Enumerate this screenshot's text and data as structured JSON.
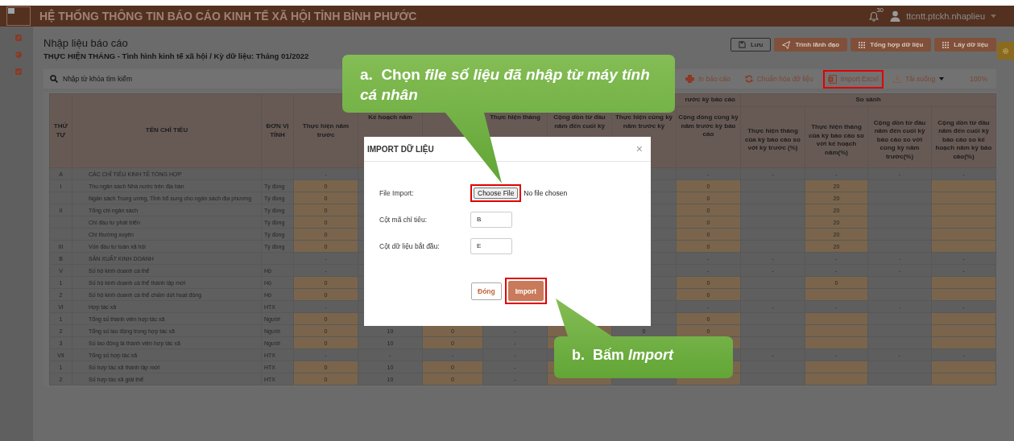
{
  "header": {
    "title": "HỆ THỐNG THÔNG TIN BÁO CÁO KINH TẾ XÃ HỘI TỈNH BÌNH PHƯỚC",
    "notification_count": "30",
    "username": "ttcntt.ptckh.nhaplieu"
  },
  "page": {
    "title": "Nhập liệu báo cáo",
    "subtitle": "THỰC HIỆN THÁNG - Tình hình kinh tế xã hội / Kỳ dữ liệu: Tháng 01/2022"
  },
  "toolbar_buttons": [
    {
      "kind": "save",
      "label": "Lưu"
    },
    {
      "kind": "send",
      "label": "Trình lãnh đạo"
    },
    {
      "kind": "grid",
      "label": "Tổng hợp dữ liệu"
    },
    {
      "kind": "grid",
      "label": "Lấy dữ liệu"
    }
  ],
  "search": {
    "placeholder": "Nhập từ khóa tìm kiếm"
  },
  "actions": [
    {
      "kind": "print",
      "label": "In báo cáo",
      "highlighted": false
    },
    {
      "kind": "refresh",
      "label": "Chuẩn hóa dữ liệu",
      "highlighted": false
    },
    {
      "kind": "excel",
      "label": "Import Excel",
      "highlighted": true
    },
    {
      "kind": "download",
      "label": "Tải xuống",
      "highlighted": false
    }
  ],
  "zoom": "100%",
  "table": {
    "header": [
      {
        "label": "THỨ TỰ",
        "editable": false
      },
      {
        "label": "TÊN CHỈ TIÊU",
        "editable": false
      },
      {
        "label": "ĐƠN VỊ TÍNH",
        "editable": false
      },
      {
        "label": "Thực hiện năm trước",
        "editable": true
      },
      {
        "columns": [
          {
            "label": "Kế hoạch năm",
            "editable": false
          },
          {
            "editable": true
          },
          {
            "label": "Thực hiện tháng",
            "editable": false
          },
          {
            "label": "Cộng dồn từ đầu năm đến cuối kỳ",
            "editable": true
          }
        ]
      },
      {
        "label": "rước kỳ báo cáo",
        "columns": [
          {
            "label": "Thực hiện cùng kỳ năm trước kỳ",
            "editable": false
          },
          {
            "label": "Cộng dồng cùng kỳ năm trước kỳ báo cáo",
            "editable": true
          }
        ]
      },
      {
        "label": "So sánh",
        "columns": [
          {
            "label": "Thực hiện tháng của kỳ báo cáo so với kỳ trước (%)",
            "editable": false
          },
          {
            "label": "Thực hiện tháng của kỳ báo cáo so với kế hoạch năm(%)",
            "editable": true
          },
          {
            "label": "Cộng dồn từ đầu năm đến cuối kỳ báo cáo so với cùng kỳ năm trước(%)",
            "editable": false
          },
          {
            "label": "Cộng dồn từ đầu năm đến cuối kỳ báo cáo so kế hoạch năm kỳ báo cáo(%)",
            "editable": true
          }
        ]
      }
    ],
    "rows": [
      {
        "kind": "section",
        "cells": [
          "A",
          "CÁC CHỈ TIÊU KINH TẾ TỔNG HỢP",
          null,
          "-",
          null,
          null,
          null,
          null,
          null,
          "-",
          "-",
          "-",
          "-",
          "-"
        ]
      },
      {
        "kind": "item",
        "cells": [
          "I",
          "Thu ngân sách Nhà nước trên địa bàn",
          "Tỷ đồng",
          "0",
          null,
          null,
          null,
          null,
          null,
          "0",
          null,
          "20",
          null,
          null
        ]
      },
      {
        "kind": "item",
        "cells": [
          null,
          "Ngân sách Trung ương, Tỉnh bổ sung cho ngân sách địa phương",
          "Tỷ đồng",
          "0",
          null,
          null,
          null,
          null,
          null,
          "0",
          null,
          "20",
          null,
          null
        ]
      },
      {
        "kind": "item",
        "cells": [
          "II",
          "Tổng chi ngân sách",
          "Tỷ đồng",
          "0",
          null,
          null,
          null,
          null,
          null,
          "0",
          null,
          "20",
          null,
          null
        ]
      },
      {
        "kind": "item",
        "cells": [
          null,
          "Chi đầu tư phát triển",
          "Tỷ đồng",
          "0",
          null,
          null,
          null,
          null,
          null,
          "0",
          null,
          "20",
          null,
          null
        ]
      },
      {
        "kind": "item",
        "cells": [
          null,
          "Chi thường xuyên",
          "Tỷ đồng",
          "0",
          null,
          null,
          null,
          null,
          null,
          "0",
          null,
          "20",
          null,
          null
        ]
      },
      {
        "kind": "item",
        "cells": [
          "III",
          "Vốn đầu tư toàn xã hội",
          "Tỷ đồng",
          "0",
          null,
          null,
          null,
          null,
          null,
          "0",
          null,
          "20",
          null,
          null
        ]
      },
      {
        "kind": "section",
        "cells": [
          "B",
          "SẢN XUẤT KINH DOANH",
          null,
          "-",
          null,
          null,
          null,
          null,
          null,
          "-",
          "-",
          "-",
          "-",
          "-"
        ]
      },
      {
        "kind": "section",
        "cells": [
          "V",
          "Số hộ kinh doanh cá thể",
          "Hộ",
          "-",
          null,
          null,
          null,
          null,
          null,
          "-",
          "-",
          "-",
          "-",
          "-"
        ]
      },
      {
        "kind": "item",
        "cells": [
          "1",
          "Số hộ kinh doanh cá thể thành lập mới",
          "Hộ",
          "0",
          null,
          null,
          null,
          null,
          null,
          "0",
          null,
          "0",
          null,
          null
        ]
      },
      {
        "kind": "item",
        "cells": [
          "2",
          "Số hộ kinh doanh cá thể chấm dứt hoạt động",
          "Hộ",
          "0",
          null,
          null,
          null,
          null,
          null,
          "0",
          null,
          null,
          null,
          null
        ]
      },
      {
        "kind": "section",
        "cells": [
          "VI",
          "Hợp tác xã",
          "HTX",
          "-",
          null,
          null,
          null,
          null,
          null,
          "-",
          "-",
          "-",
          "-",
          "-"
        ]
      },
      {
        "kind": "item",
        "cells": [
          "1",
          "Tổng số thành viên hợp tác xã",
          "Người",
          "0",
          null,
          null,
          null,
          null,
          null,
          "0",
          null,
          null,
          null,
          null
        ]
      },
      {
        "kind": "item",
        "cells": [
          "2",
          "Tổng số lao động trong hợp tác xã",
          "Người",
          "0",
          "10",
          "0",
          "-",
          null,
          "0",
          "0",
          null,
          null,
          null,
          null
        ]
      },
      {
        "kind": "item",
        "cells": [
          "3",
          "Số lao động là thành viên hợp tác xã",
          "Người",
          "0",
          "10",
          "0",
          "-",
          null,
          null,
          null,
          null,
          null,
          null,
          null
        ]
      },
      {
        "kind": "section",
        "cells": [
          "VII",
          "Tổng số hợp tác xã",
          "HTX",
          "-",
          "-",
          "-",
          "-",
          null,
          null,
          null,
          "-",
          "-",
          "-",
          "-"
        ]
      },
      {
        "kind": "item",
        "cells": [
          "1",
          "Số hợp tác xã thành lập mới",
          "HTX",
          "0",
          "10",
          "0",
          "-",
          null,
          null,
          null,
          null,
          null,
          null,
          null
        ]
      },
      {
        "kind": "item",
        "cells": [
          "2",
          "Số hợp tác xã giải thể",
          "HTX",
          "0",
          "10",
          "0",
          "-",
          null,
          null,
          null,
          null,
          null,
          null,
          null
        ]
      }
    ]
  },
  "dialog": {
    "title": "IMPORT DỮ LIỆU",
    "close": "×",
    "fields": [
      {
        "kind": "file",
        "label": "File Import:",
        "button": "Choose File",
        "value": "No file chosen",
        "highlighted": true
      },
      {
        "kind": "text",
        "label": "Cột mã chỉ tiêu:",
        "value": "B",
        "highlighted": false
      },
      {
        "kind": "text",
        "label": "Cột dữ liệu bắt đầu:",
        "value": "E",
        "highlighted": false
      }
    ],
    "buttons": [
      {
        "kind": "secondary",
        "label": "Đóng",
        "highlighted": false
      },
      {
        "kind": "primary",
        "label": "Import",
        "highlighted": true
      }
    ]
  },
  "callouts": [
    {
      "text": "a.  Chọn *file số liệu đã nhập từ máy tính cá nhân*"
    },
    {
      "text": "b.  Bấm *Import*"
    }
  ]
}
